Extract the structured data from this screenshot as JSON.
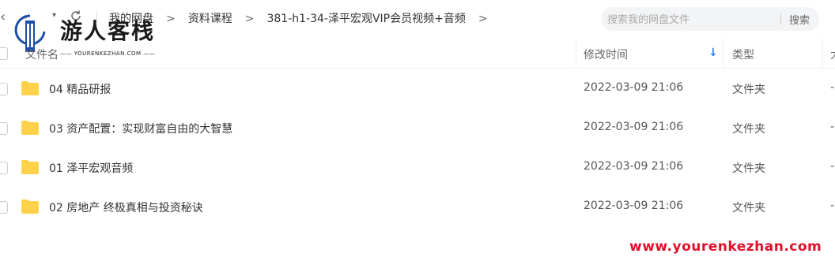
{
  "nav": {
    "back_glyph": "‹",
    "forward_glyph": "›",
    "dropdown_glyph": "▾"
  },
  "breadcrumb": {
    "items": [
      "我的网盘",
      "资料课程",
      "381-h1-34-泽平宏观VIP会员视频+音频"
    ],
    "arrow": ">"
  },
  "search": {
    "placeholder": "搜索我的网盘文件",
    "button_label": "搜索"
  },
  "logo": {
    "name": "游人客栈",
    "subtitle": "—— YOURENKEZHAN.COM ——"
  },
  "table": {
    "headers": {
      "name": "文件名",
      "modified": "修改时间",
      "sort_indicator": "↓",
      "type": "类型",
      "size": "大"
    },
    "rows": [
      {
        "name": "04 精品研报",
        "modified": "2022-03-09 21:06",
        "type": "文件夹",
        "size": "-"
      },
      {
        "name": "03 资产配置：实现财富自由的大智慧",
        "modified": "2022-03-09 21:06",
        "type": "文件夹",
        "size": "-"
      },
      {
        "name": "01 泽平宏观音频",
        "modified": "2022-03-09 21:06",
        "type": "文件夹",
        "size": "-"
      },
      {
        "name": "02 房地产 终极真相与投资秘诀",
        "modified": "2022-03-09 21:06",
        "type": "文件夹",
        "size": "-"
      }
    ]
  },
  "watermark": {
    "url": "www.yourenkezhan.com"
  },
  "colors": {
    "folder": "#ffd24a",
    "accent": "#2f7cf6",
    "watermark": "#e0102a"
  }
}
